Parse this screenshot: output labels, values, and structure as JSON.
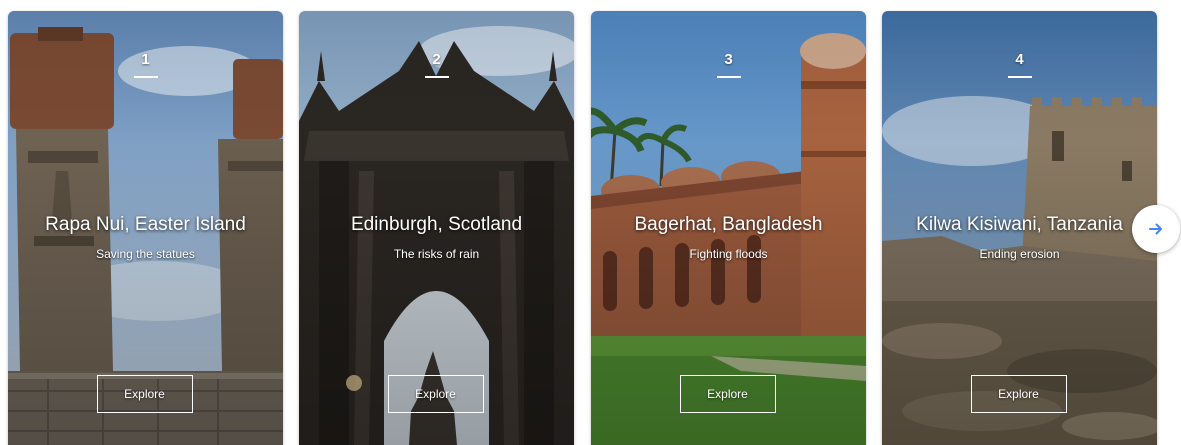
{
  "cards": [
    {
      "number": "1",
      "title": "Rapa Nui, Easter Island",
      "subtitle": "Saving the statues",
      "button": "Explore"
    },
    {
      "number": "2",
      "title": "Edinburgh, Scotland",
      "subtitle": "The risks of rain",
      "button": "Explore"
    },
    {
      "number": "3",
      "title": "Bagerhat, Bangladesh",
      "subtitle": "Fighting floods",
      "button": "Explore"
    },
    {
      "number": "4",
      "title": "Kilwa Kisiwani, Tanzania",
      "subtitle": "Ending erosion",
      "button": "Explore"
    }
  ],
  "next_button_icon": "arrow-right-icon",
  "colors": {
    "accent": "#4285f4"
  }
}
